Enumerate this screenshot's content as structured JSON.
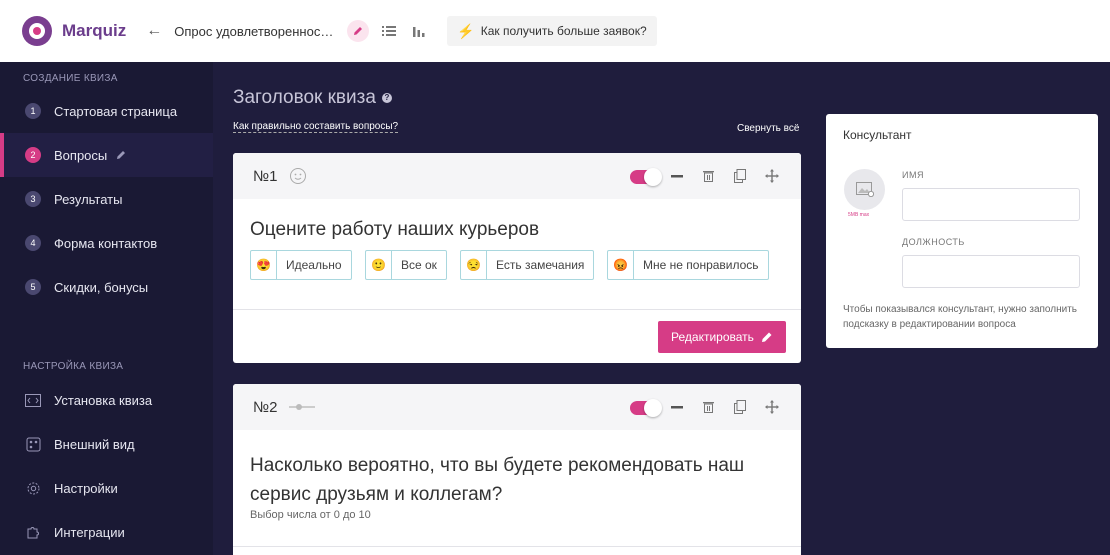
{
  "header": {
    "brand": "Marquiz",
    "back_icon": "arrow-left-icon",
    "quiz_title": "Опрос удовлетвореннос…",
    "tip_label": "Как получить больше заявок?"
  },
  "sidebar": {
    "section_create": "СОЗДАНИЕ КВИЗА",
    "steps": [
      {
        "num": "1",
        "label": "Стартовая страница"
      },
      {
        "num": "2",
        "label": "Вопросы"
      },
      {
        "num": "3",
        "label": "Результаты"
      },
      {
        "num": "4",
        "label": "Форма контактов"
      },
      {
        "num": "5",
        "label": "Скидки, бонусы"
      }
    ],
    "section_settings": "НАСТРОЙКА КВИЗА",
    "settings": [
      {
        "icon": "code-icon",
        "label": "Установка квиза"
      },
      {
        "icon": "palette-icon",
        "label": "Внешний вид"
      },
      {
        "icon": "gear-icon",
        "label": "Настройки"
      },
      {
        "icon": "puzzle-icon",
        "label": "Интеграции"
      }
    ]
  },
  "main": {
    "title": "Заголовок квиза",
    "how_link": "Как правильно составить вопросы?",
    "collapse_all": "Свернуть всё",
    "questions": [
      {
        "number": "№1",
        "text": "Оцените работу наших курьеров",
        "options": [
          {
            "emoji": "😍",
            "label": "Идеально"
          },
          {
            "emoji": "🙂",
            "label": "Все ок"
          },
          {
            "emoji": "😒",
            "label": "Есть замечания"
          },
          {
            "emoji": "😡",
            "label": "Мне не понравилось"
          }
        ],
        "edit_label": "Редактировать"
      },
      {
        "number": "№2",
        "text_line1": "Насколько вероятно, что вы будете рекомендовать наш",
        "text_line2": "сервис друзьям и коллегам?",
        "subtitle": "Выбор числа от 0 до 10"
      }
    ]
  },
  "consultant": {
    "title": "Консультант",
    "avatar_note": "5MB max",
    "name_label": "ИМЯ",
    "position_label": "ДОЛЖНОСТЬ",
    "hint": "Чтобы показывался консультант, нужно заполнить подсказку в редактировании вопроса"
  },
  "colors": {
    "accent": "#d63c86",
    "sidebar_bg": "#1a1934",
    "main_bg": "#1f1d3d"
  }
}
